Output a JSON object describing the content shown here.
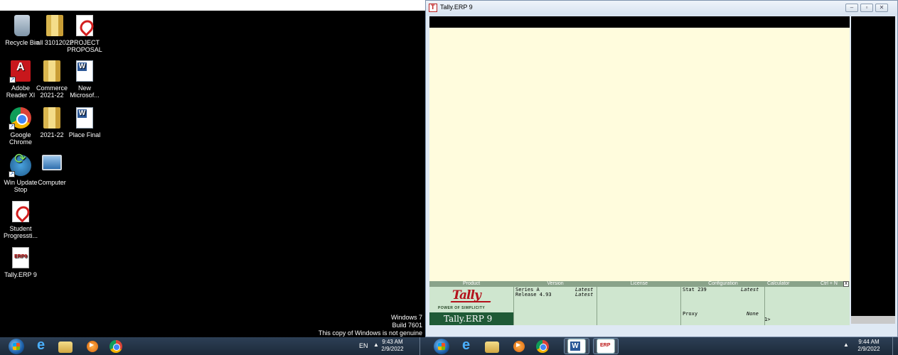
{
  "left_desktop": {
    "icons": [
      {
        "label": "Recycle Bin",
        "icon": "recycle-bin-icon"
      },
      {
        "label": "all 31012022",
        "icon": "folder-icon"
      },
      {
        "label": "PROJECT PROPOSAL",
        "icon": "pdf-file-icon"
      },
      {
        "label": "Adobe Reader XI",
        "icon": "adobe-reader-icon"
      },
      {
        "label": "Commerce 2021-22",
        "icon": "folder-icon"
      },
      {
        "label": "New Microsof...",
        "icon": "word-document-icon"
      },
      {
        "label": "Google Chrome",
        "icon": "chrome-icon"
      },
      {
        "label": "2021-22",
        "icon": "folder-icon"
      },
      {
        "label": "Place Final",
        "icon": "word-document-icon"
      },
      {
        "label": "Win Update Stop",
        "icon": "windows-update-icon"
      },
      {
        "label": "Computer",
        "icon": "computer-icon"
      },
      {
        "label": "Student Progressti...",
        "icon": "pdf-file-icon"
      },
      {
        "label": "Tally.ERP 9",
        "icon": "tally-erp-icon"
      }
    ],
    "watermark": {
      "line1": "Windows 7",
      "line2": "Build 7601",
      "line3": "This copy of Windows is not genuine"
    },
    "taskbar": {
      "lang": "EN",
      "tray_arrow": "▲",
      "time": "9:43 AM",
      "date": "2/9/2022"
    }
  },
  "tally_window": {
    "title": "Tally.ERP 9",
    "minimize": "–",
    "restore": "▫",
    "close": "✕",
    "info_panel": {
      "headers": {
        "product": "Product",
        "version": "Version",
        "license": "License",
        "configuration": "Configuration",
        "calculator": "Calculator",
        "shortcut": "Ctrl + N"
      },
      "logo_text": "Tally",
      "tagline": "POWER OF SIMPLICITY",
      "product_name": "Tally.ERP 9",
      "version": {
        "series": "Series A",
        "series_status": "Latest",
        "release": "Release 4.93",
        "release_status": "Latest"
      },
      "configuration": {
        "stat": "Stat  239",
        "stat_status": "Latest",
        "proxy": "Proxy",
        "proxy_status": "None"
      },
      "calculator_prompt": "1>",
      "close_x": "x"
    }
  },
  "right_taskbar": {
    "time": "9:44 AM",
    "date": "2/9/2022",
    "tray_arrow": "▲"
  },
  "colors": {
    "desktop_bg": "#000000",
    "tally_cream": "#fffcdd",
    "tally_green_panel": "#cfe6cf",
    "tally_dark_green": "#1f5a36",
    "tally_red": "#b3111b",
    "taskbar": "#1c2a3a"
  }
}
